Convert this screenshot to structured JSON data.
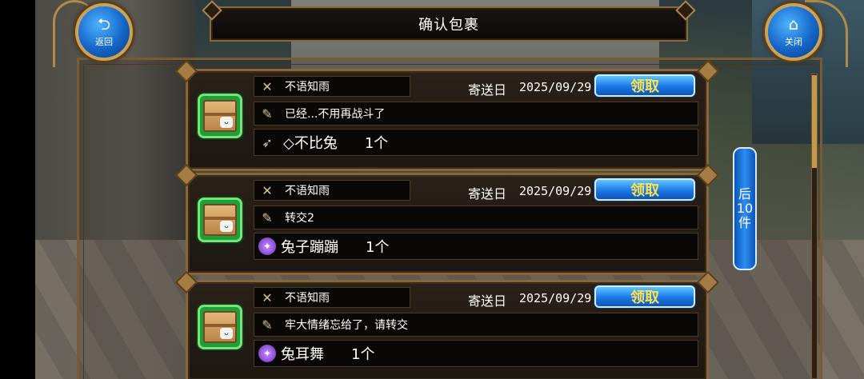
{
  "header": {
    "title": "确认包裹",
    "back_label": "返回",
    "back_icon": "back-arrow-icon",
    "close_label": "关闭",
    "close_icon": "home-icon"
  },
  "mails": [
    {
      "sender": "不语知雨",
      "sent_label": "寄送日",
      "date": "2025/09/29",
      "claim_label": "领取",
      "message": "已经...不用再战斗了",
      "item_name": "◇不比兔",
      "item_qty": "1个",
      "item_icon": "feather-icon"
    },
    {
      "sender": "不语知雨",
      "sent_label": "寄送日",
      "date": "2025/09/29",
      "claim_label": "领取",
      "message": "转交2",
      "item_name": "兔子蹦蹦",
      "item_qty": "1个",
      "item_icon": "magic-orb-icon"
    },
    {
      "sender": "不语知雨",
      "sent_label": "寄送日",
      "date": "2025/09/29",
      "claim_label": "领取",
      "message": "牢大情绪忘给了，请转交",
      "item_name": "兔耳舞",
      "item_qty": "1个",
      "item_icon": "magic-orb-icon"
    }
  ],
  "next_page": {
    "line1": "后",
    "line2": "10",
    "line3": "件"
  },
  "colors": {
    "accent_gold": "#c9a35a",
    "button_blue": "#1a78e6",
    "claim_text": "#ffe14a",
    "package_green": "#1d9f3a"
  }
}
